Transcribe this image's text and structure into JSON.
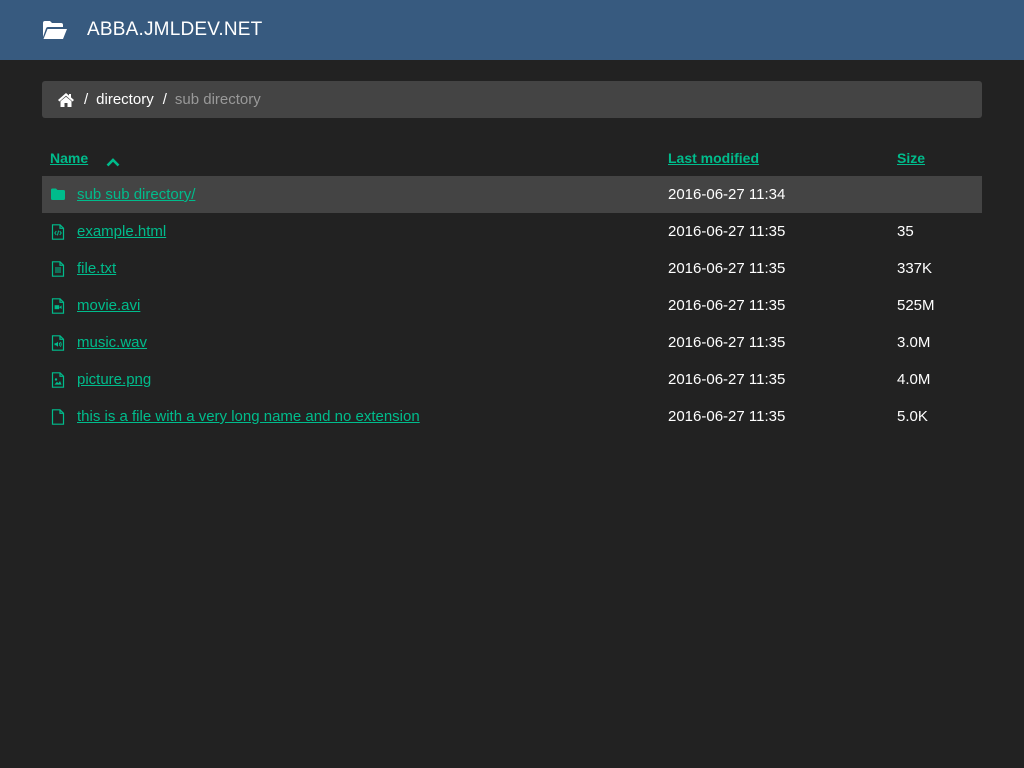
{
  "header": {
    "site_title": "ABBA.JMLDEV.NET",
    "logo_icon": "folder-open-icon",
    "background": "#375a7f"
  },
  "breadcrumb": {
    "home_icon": "home-icon",
    "separator": "/",
    "items": [
      {
        "label": "directory",
        "active": false
      },
      {
        "label": "sub directory",
        "active": true
      }
    ]
  },
  "table": {
    "columns": {
      "name": "Name",
      "last_modified": "Last modified",
      "size": "Size"
    },
    "sort": {
      "column": "name",
      "direction": "ascending",
      "icon": "chevron-up-icon"
    },
    "rows": [
      {
        "icon": "folder-icon",
        "name": "sub sub directory/",
        "modified": "2016-06-27 11:34",
        "size": ""
      },
      {
        "icon": "file-code-icon",
        "name": "example.html",
        "modified": "2016-06-27 11:35",
        "size": "35"
      },
      {
        "icon": "file-text-icon",
        "name": "file.txt",
        "modified": "2016-06-27 11:35",
        "size": "337K"
      },
      {
        "icon": "file-video-icon",
        "name": "movie.avi",
        "modified": "2016-06-27 11:35",
        "size": "525M"
      },
      {
        "icon": "file-audio-icon",
        "name": "music.wav",
        "modified": "2016-06-27 11:35",
        "size": "3.0M"
      },
      {
        "icon": "file-image-icon",
        "name": "picture.png",
        "modified": "2016-06-27 11:35",
        "size": "4.0M"
      },
      {
        "icon": "file-icon",
        "name": "this is a file with a very long name and no extension",
        "modified": "2016-06-27 11:35",
        "size": "5.0K"
      }
    ]
  },
  "colors": {
    "accent": "#00bc8c",
    "background": "#222222",
    "panel": "#444444",
    "muted": "#999999"
  }
}
